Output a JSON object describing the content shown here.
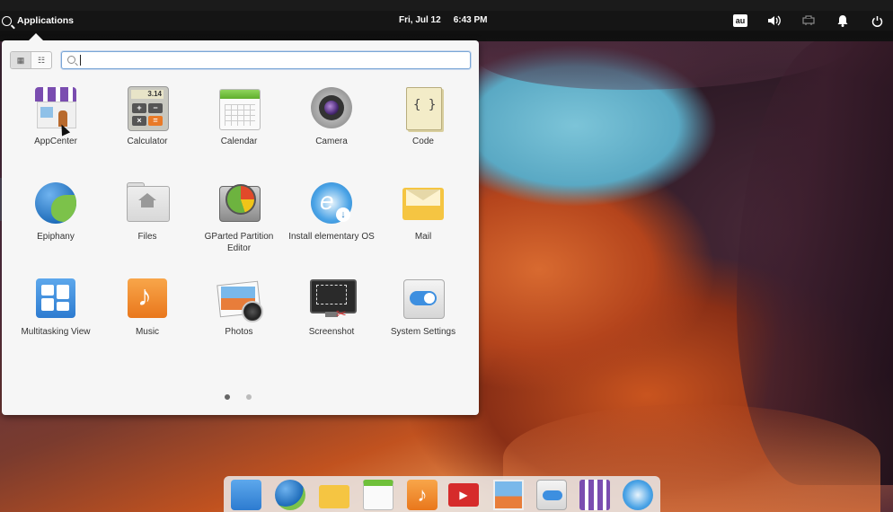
{
  "panel": {
    "applications_label": "Applications",
    "date": "Fri, Jul 12",
    "time": "6:43 PM",
    "keyboard_layout": "au"
  },
  "launcher": {
    "search_placeholder": "",
    "apps": [
      {
        "label": "AppCenter",
        "icon": "appcenter-icon"
      },
      {
        "label": "Calculator",
        "icon": "calculator-icon"
      },
      {
        "label": "Calendar",
        "icon": "calendar-icon"
      },
      {
        "label": "Camera",
        "icon": "camera-icon"
      },
      {
        "label": "Code",
        "icon": "code-icon"
      },
      {
        "label": "Epiphany",
        "icon": "epiphany-icon"
      },
      {
        "label": "Files",
        "icon": "files-icon"
      },
      {
        "label": "GParted Partition Editor",
        "icon": "gparted-icon"
      },
      {
        "label": "Install elementary OS",
        "icon": "install-icon"
      },
      {
        "label": "Mail",
        "icon": "mail-icon"
      },
      {
        "label": "Multitasking View",
        "icon": "multitasking-icon"
      },
      {
        "label": "Music",
        "icon": "music-icon"
      },
      {
        "label": "Photos",
        "icon": "photos-icon"
      },
      {
        "label": "Screenshot",
        "icon": "screenshot-icon"
      },
      {
        "label": "System Settings",
        "icon": "settings-icon"
      }
    ],
    "calc_display": "3.14",
    "pages": 2,
    "current_page": 1
  },
  "dock": {
    "items": [
      "multitasking-icon",
      "epiphany-icon",
      "mail-icon",
      "calendar-icon",
      "music-icon",
      "videos-icon",
      "photos-icon",
      "settings-icon",
      "appcenter-icon",
      "install-icon"
    ]
  },
  "colors": {
    "accent": "#3d8fe0",
    "panel_bg": "#151515",
    "launcher_bg": "#f6f6f6"
  }
}
